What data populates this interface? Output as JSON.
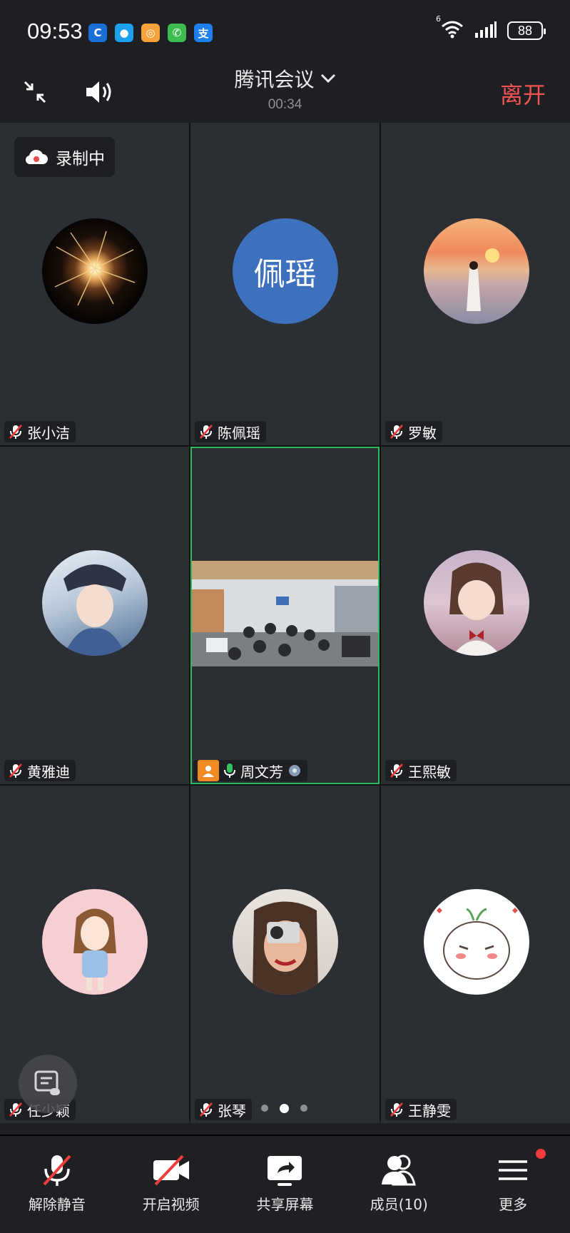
{
  "status_bar": {
    "time": "09:53",
    "app_icons": [
      {
        "name": "app-c-icon",
        "glyph": "C",
        "color": "#1a6fd6"
      },
      {
        "name": "message-bubble-icon",
        "glyph": "●",
        "color": "#1ea0f0"
      },
      {
        "name": "app-orange-icon",
        "glyph": "◎",
        "color": "#f7a23a"
      },
      {
        "name": "phone-icon",
        "glyph": "✆",
        "color": "#3dbb4f"
      },
      {
        "name": "alipay-icon",
        "glyph": "支",
        "color": "#1d7ff0"
      }
    ],
    "wifi_label": "6",
    "battery": "88"
  },
  "top_bar": {
    "title": "腾讯会议",
    "duration": "00:34",
    "leave_label": "离开"
  },
  "recording_badge": "录制中",
  "participants": [
    {
      "name": "张小洁",
      "avatar": "firework"
    },
    {
      "name": "陈佩瑶",
      "avatar": "text",
      "avatar_text": "佩瑶",
      "avatar_color": "#3d70bd"
    },
    {
      "name": "罗敏",
      "avatar": "sunset"
    },
    {
      "name": "黄雅迪",
      "avatar": "anime-boy"
    },
    {
      "name": "周文芳",
      "avatar": "video",
      "host": true,
      "mic_on": true
    },
    {
      "name": "王熙敏",
      "avatar": "girl-bow"
    },
    {
      "name": "任少颖",
      "avatar": "cartoon-girl"
    },
    {
      "name": "张琴",
      "avatar": "camera-girl"
    },
    {
      "name": "王静雯",
      "avatar": "cute-face"
    }
  ],
  "pager": {
    "pages": 3,
    "current": 2
  },
  "bottom_bar": {
    "unmute": "解除静音",
    "video": "开启视频",
    "share": "共享屏幕",
    "members": "成员(10)",
    "more": "更多"
  }
}
